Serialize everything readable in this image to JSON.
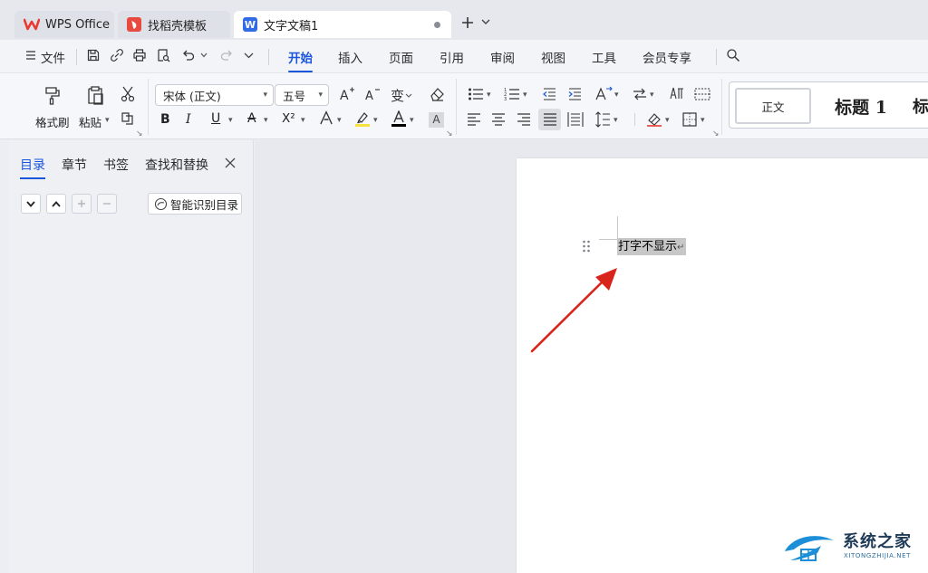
{
  "tabs": [
    {
      "label": "WPS Office",
      "icon": "wps-logo-icon"
    },
    {
      "label": "找稻壳模板",
      "icon": "docer-logo-icon"
    },
    {
      "label": "文字文稿1",
      "icon": "writer-doc-icon",
      "icon_letter": "W"
    }
  ],
  "menu": {
    "file": "文件",
    "items": [
      "开始",
      "插入",
      "页面",
      "引用",
      "审阅",
      "视图",
      "工具",
      "会员专享"
    ],
    "active": "开始"
  },
  "ribbon": {
    "format_painter": "格式刷",
    "paste": "粘贴",
    "font_name": "宋体 (正文)",
    "font_size": "五号",
    "bold": "B",
    "italic": "I",
    "underline": "U",
    "strikethrough": "A",
    "superscript": "X²",
    "char_shading": "A",
    "styles": [
      "正文",
      "标题 1",
      "标"
    ]
  },
  "panel": {
    "tabs": [
      "目录",
      "章节",
      "书签",
      "查找和替换"
    ],
    "active_tab": "目录",
    "smart_toc_button": "智能识别目录"
  },
  "document": {
    "text": "打字不显示",
    "para_mark": "↵"
  },
  "watermark": {
    "name": "系统之家",
    "url": "XITONGZHIJIA.NET"
  },
  "colors": {
    "accent": "#1a56db",
    "wps_red": "#e83a30",
    "arrow_red": "#d9241c",
    "highlight_yellow": "#f5e23a",
    "font_color_black": "#000000"
  }
}
